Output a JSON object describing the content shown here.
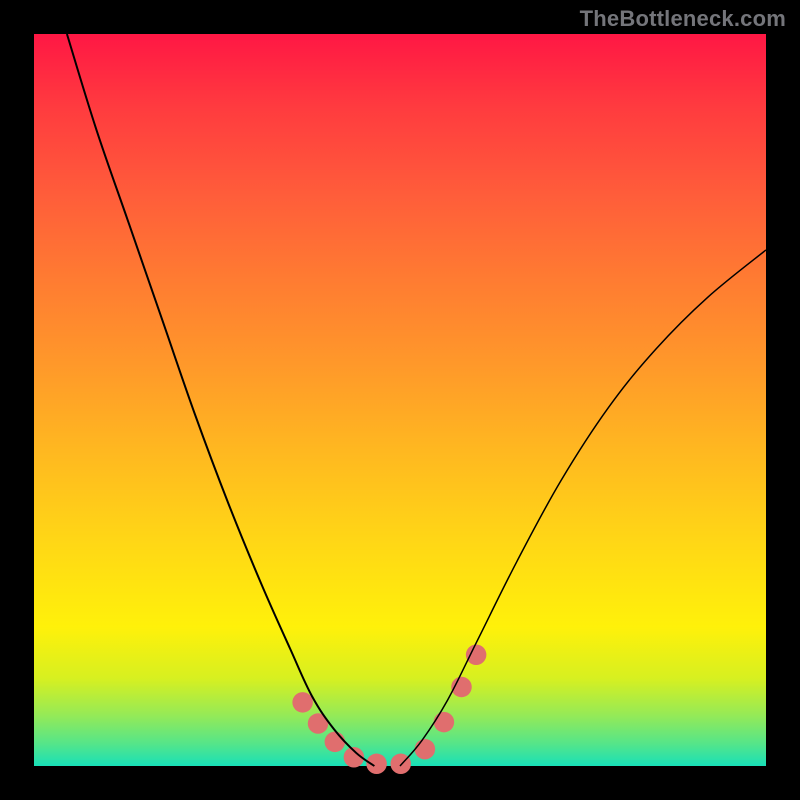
{
  "watermark": "TheBottleneck.com",
  "chart_data": {
    "type": "line",
    "title": "",
    "xlabel": "",
    "ylabel": "",
    "xlim": [
      0,
      1
    ],
    "ylim": [
      0,
      1
    ],
    "series": [
      {
        "name": "left-curve",
        "x": [
          0.045,
          0.085,
          0.13,
          0.175,
          0.22,
          0.265,
          0.31,
          0.35,
          0.38,
          0.41,
          0.44,
          0.465
        ],
        "y": [
          1.0,
          0.87,
          0.74,
          0.61,
          0.48,
          0.36,
          0.25,
          0.16,
          0.095,
          0.05,
          0.018,
          0.0
        ]
      },
      {
        "name": "right-curve",
        "x": [
          0.5,
          0.53,
          0.565,
          0.605,
          0.66,
          0.72,
          0.785,
          0.85,
          0.92,
          1.0
        ],
        "y": [
          0.0,
          0.035,
          0.09,
          0.17,
          0.28,
          0.39,
          0.49,
          0.57,
          0.64,
          0.705
        ]
      }
    ],
    "annotations": {
      "highlight_blobs": [
        {
          "x": 0.367,
          "y": 0.087,
          "r": 0.014
        },
        {
          "x": 0.388,
          "y": 0.058,
          "r": 0.014
        },
        {
          "x": 0.411,
          "y": 0.033,
          "r": 0.014
        },
        {
          "x": 0.437,
          "y": 0.012,
          "r": 0.014
        },
        {
          "x": 0.468,
          "y": 0.003,
          "r": 0.014
        },
        {
          "x": 0.501,
          "y": 0.003,
          "r": 0.014
        },
        {
          "x": 0.534,
          "y": 0.023,
          "r": 0.014
        },
        {
          "x": 0.56,
          "y": 0.06,
          "r": 0.014
        },
        {
          "x": 0.584,
          "y": 0.108,
          "r": 0.014
        },
        {
          "x": 0.604,
          "y": 0.152,
          "r": 0.014
        }
      ]
    }
  }
}
